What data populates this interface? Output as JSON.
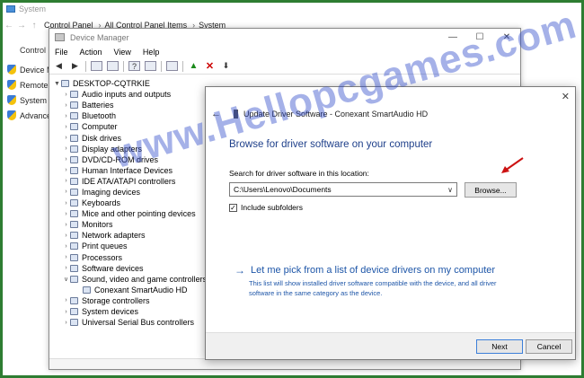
{
  "system_window": {
    "title": "System",
    "breadcrumb": [
      "Control Panel",
      "All Control Panel Items",
      "System"
    ],
    "left_pane_home": "Control P",
    "links": [
      "Device M",
      "Remote s",
      "System pr",
      "Advanced"
    ]
  },
  "device_manager": {
    "title": "Device Manager",
    "window_controls": [
      "—",
      "☐",
      "✕"
    ],
    "menu": [
      "File",
      "Action",
      "View",
      "Help"
    ],
    "tree_root": "DESKTOP-CQTRKIE",
    "tree_nodes": [
      {
        "label": "Audio inputs and outputs",
        "expanded": false
      },
      {
        "label": "Batteries",
        "expanded": false
      },
      {
        "label": "Bluetooth",
        "expanded": false
      },
      {
        "label": "Computer",
        "expanded": false
      },
      {
        "label": "Disk drives",
        "expanded": false
      },
      {
        "label": "Display adapters",
        "expanded": false
      },
      {
        "label": "DVD/CD-ROM drives",
        "expanded": false
      },
      {
        "label": "Human Interface Devices",
        "expanded": false
      },
      {
        "label": "IDE ATA/ATAPI controllers",
        "expanded": false
      },
      {
        "label": "Imaging devices",
        "expanded": false
      },
      {
        "label": "Keyboards",
        "expanded": false
      },
      {
        "label": "Mice and other pointing devices",
        "expanded": false
      },
      {
        "label": "Monitors",
        "expanded": false
      },
      {
        "label": "Network adapters",
        "expanded": false
      },
      {
        "label": "Print queues",
        "expanded": false
      },
      {
        "label": "Processors",
        "expanded": false
      },
      {
        "label": "Software devices",
        "expanded": false
      },
      {
        "label": "Sound, video and game controllers",
        "expanded": true
      },
      {
        "label": "Conexant SmartAudio HD",
        "child": true
      },
      {
        "label": "Storage controllers",
        "expanded": false
      },
      {
        "label": "System devices",
        "expanded": false
      },
      {
        "label": "Universal Serial Bus controllers",
        "expanded": false
      }
    ]
  },
  "dialog": {
    "header": "Update Driver Software - Conexant SmartAudio HD",
    "heading": "Browse for driver software on your computer",
    "search_label": "Search for driver software in this location:",
    "path_value": "C:\\Users\\Lenovo\\Documents",
    "browse_label": "Browse...",
    "include_subfolders": "Include subfolders",
    "pick_title": "Let me pick from a list of device drivers on my computer",
    "pick_desc": "This list will show installed driver software compatible with the device, and all driver software in the same category as the device.",
    "next_label": "Next",
    "cancel_label": "Cancel"
  },
  "watermark": "www.Hellopcgames.com",
  "colors": {
    "frame": "#2e7d32",
    "heading": "#1e3f8a",
    "link": "#1e56a8",
    "arrow": "#cc1111"
  }
}
